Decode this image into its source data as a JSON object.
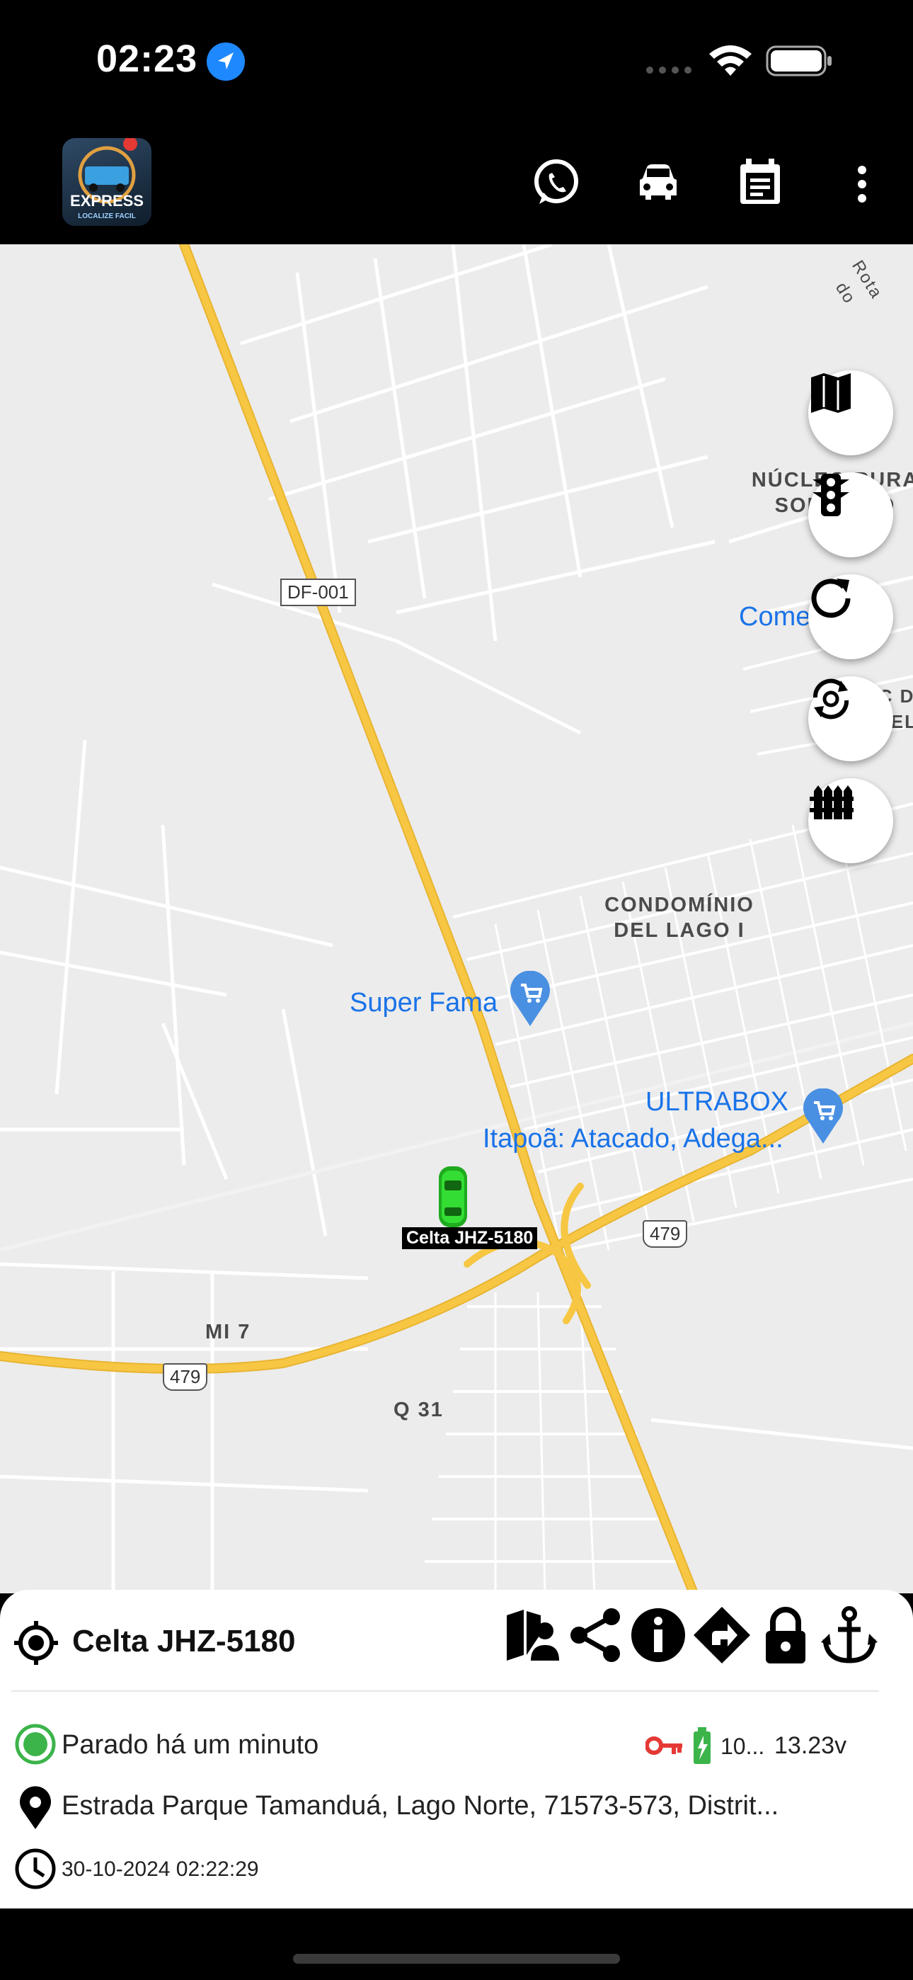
{
  "status_bar": {
    "time": "02:23"
  },
  "app": {
    "logo_text": "EXPRESS",
    "logo_subtext": "LOCALIZE FACIL"
  },
  "map": {
    "road_labels": [
      "DF-001",
      "479",
      "479"
    ],
    "area_labels": [
      "NÚCLEO RURA SOBRE HO",
      "CONDOMÍNIO DEL LAGO I",
      "MI 7",
      "Q 31",
      "C D DEL"
    ],
    "pois": [
      "Super Fama",
      "ULTRABOX",
      "Itapoã: Atacado, Adega...",
      "Come ei"
    ],
    "place_corner": "Rota do",
    "vehicle_marker_label": "Celta JHZ-5180",
    "colors": {
      "highway": "#f7c744",
      "road": "#ffffff",
      "land": "#ececec",
      "poi": "#1a73e8",
      "car": "#22cc22"
    }
  },
  "panel": {
    "vehicle_name": "Celta JHZ-5180",
    "status_text": "Parado há um minuto",
    "battery_percent": "10...",
    "voltage": "13.23v",
    "address": "Estrada Parque Tamanduá, Lago Norte, 71573-573, Distrit...",
    "timestamp": "30-10-2024 02:22:29",
    "colors": {
      "status_ok": "#3cb44a",
      "key": "#e53935",
      "battery": "#3cb44a"
    }
  }
}
